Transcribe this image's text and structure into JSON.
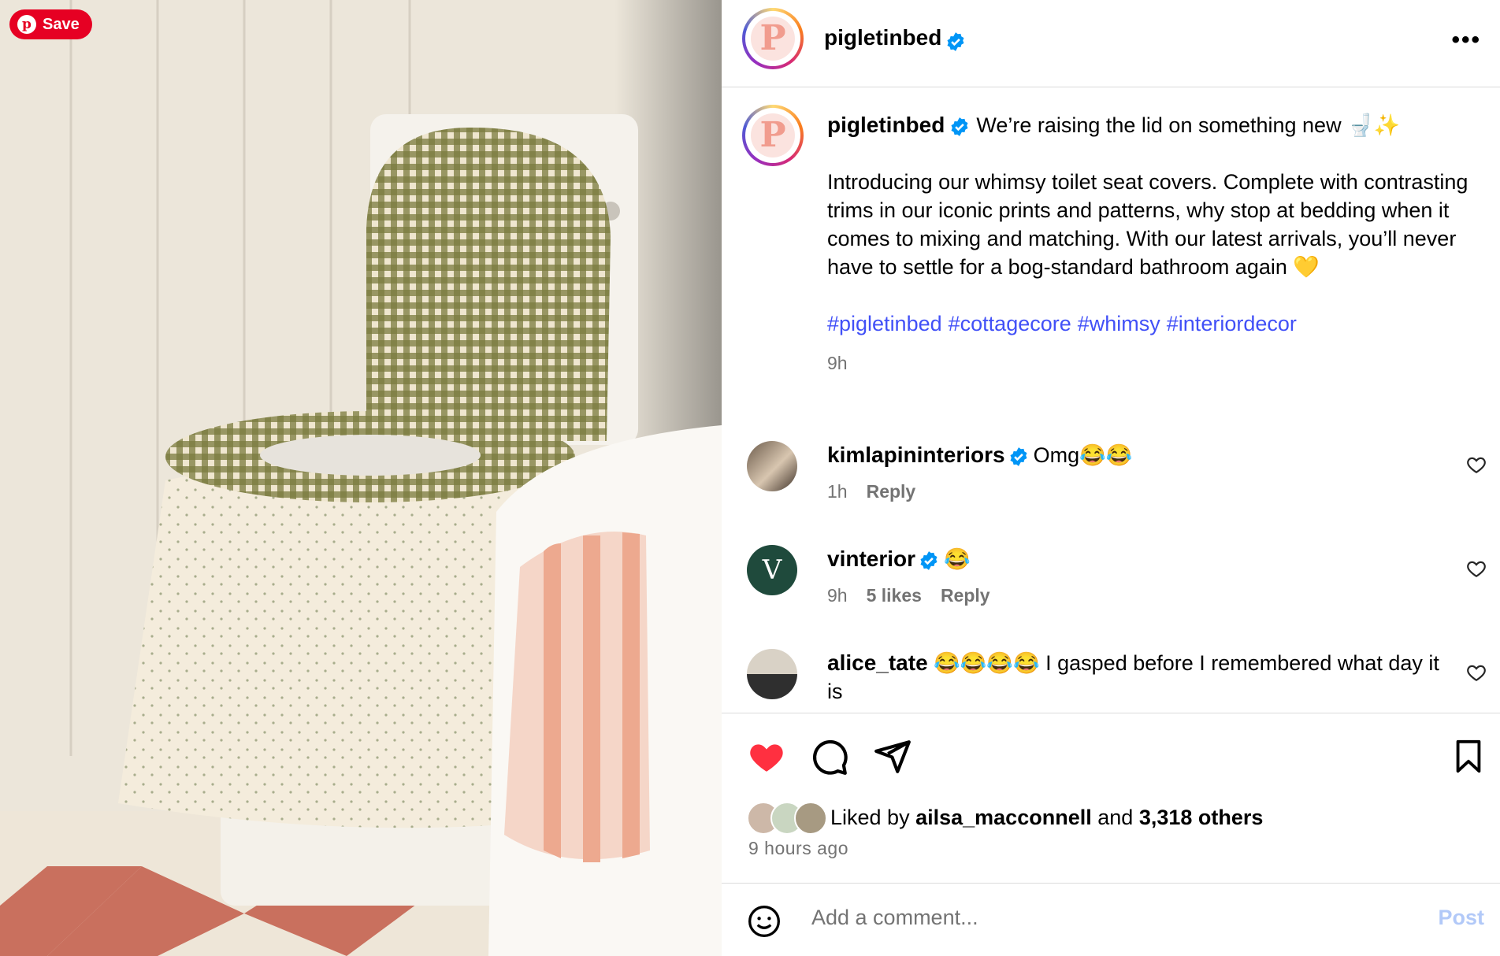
{
  "pinterest": {
    "save_label": "Save"
  },
  "header": {
    "username": "pigletinbed",
    "logo_letter": "P",
    "more_icon": "ellipsis-icon"
  },
  "caption": {
    "username": "pigletinbed",
    "headline": "We’re raising the lid on something new 🚽✨",
    "body": "Introducing our whimsy toilet seat covers. Complete with contrasting trims in our iconic prints and patterns, why stop at bedding when it comes to mixing and matching. With our latest arrivals, you’ll never have to settle for a bog-standard bathroom again 💛",
    "hashtags": [
      "#pigletinbed",
      "#cottagecore",
      "#whimsy",
      "#interiordecor"
    ],
    "time": "9h"
  },
  "comments": [
    {
      "username": "kimlapininteriors",
      "text": "Omg😂😂",
      "time": "1h",
      "reply": "Reply"
    },
    {
      "username": "vinterior",
      "avatar_letter": "V",
      "text": "😂",
      "time": "9h",
      "likes": "5 likes",
      "reply": "Reply"
    },
    {
      "username": "alice_tate",
      "text": "😂😂😂😂 I gasped before I remembered what day it is"
    }
  ],
  "likes": {
    "prefix": "Liked by",
    "user": "ailsa_macconnell",
    "middle": "and",
    "others": "3,318 others"
  },
  "posted_ago": "9 hours ago",
  "add_comment": {
    "placeholder": "Add a comment...",
    "post_label": "Post"
  },
  "colors": {
    "like_red": "#ff3040",
    "link_blue": "#4150f7",
    "verified_blue": "#0095f6",
    "pinterest_red": "#e60023"
  }
}
